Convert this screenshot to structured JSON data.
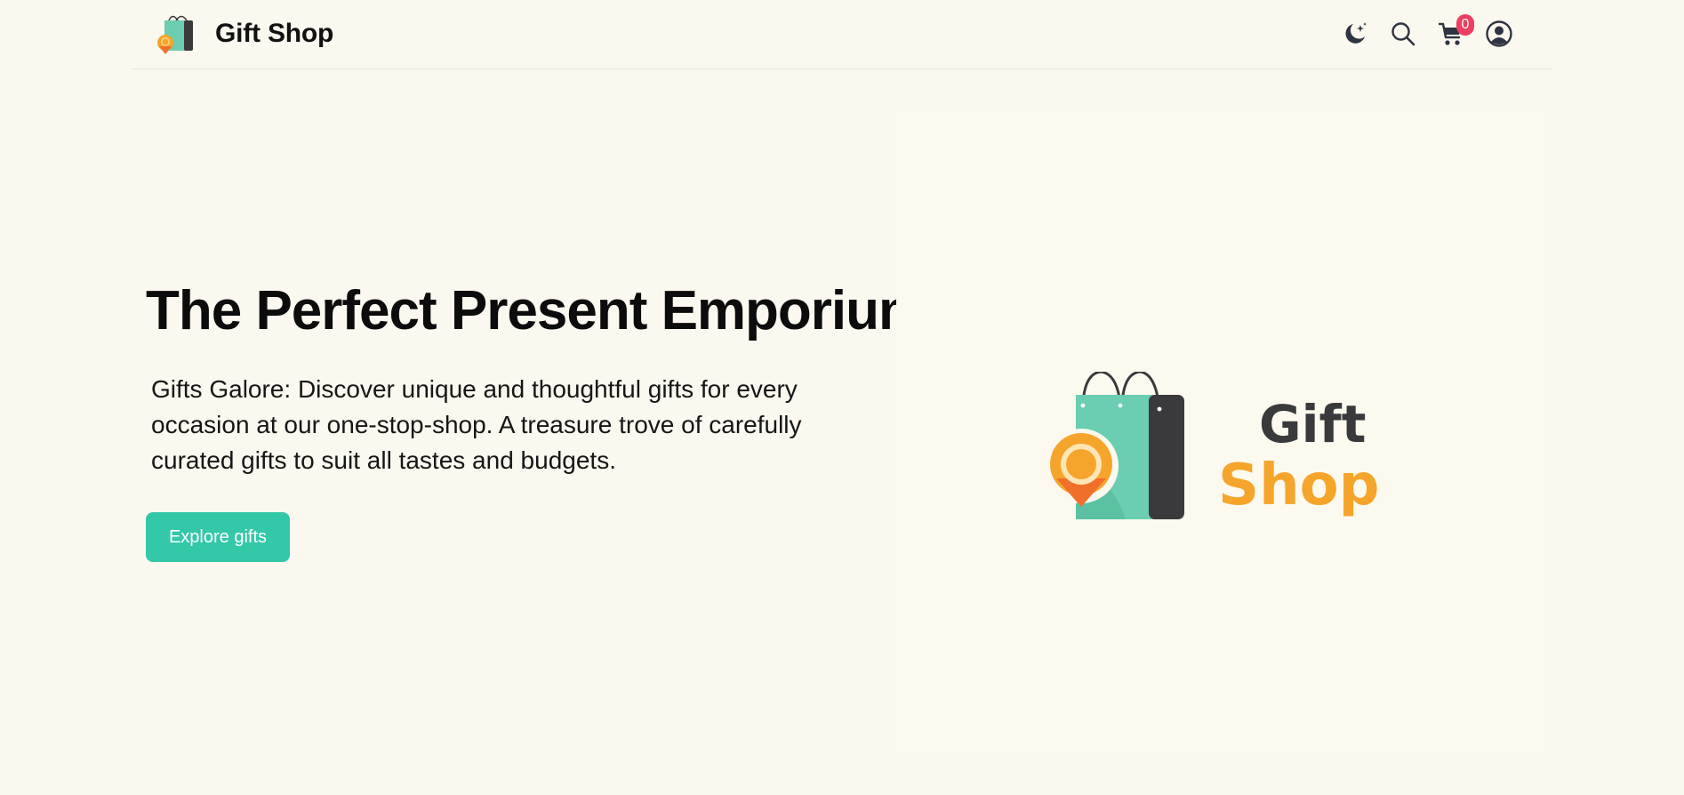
{
  "header": {
    "brand_name": "Gift Shop"
  },
  "nav_icons": [
    "moon-stars-icon",
    "search-icon",
    "cart-icon",
    "user-circle-icon"
  ],
  "cart": {
    "count": "0"
  },
  "hero": {
    "title": "The Perfect Present Emporium",
    "description": "Gifts Galore: Discover unique and thoughtful gifts for every occasion at our one-stop-shop. A treasure trove of carefully curated gifts to suit all tastes and budgets.",
    "cta_label": "Explore gifts"
  },
  "logo": {
    "word1": "Gift",
    "word2": "Shop"
  },
  "colors": {
    "background": "#fbf8ef",
    "accent_teal": "#33c8a8",
    "bag_teal": "#6bcdb1",
    "bag_dark": "#3a3a3c",
    "pin_orange": "#f6a52c",
    "pin_deep_orange": "#f0702a",
    "badge_red": "#ec3f61"
  }
}
